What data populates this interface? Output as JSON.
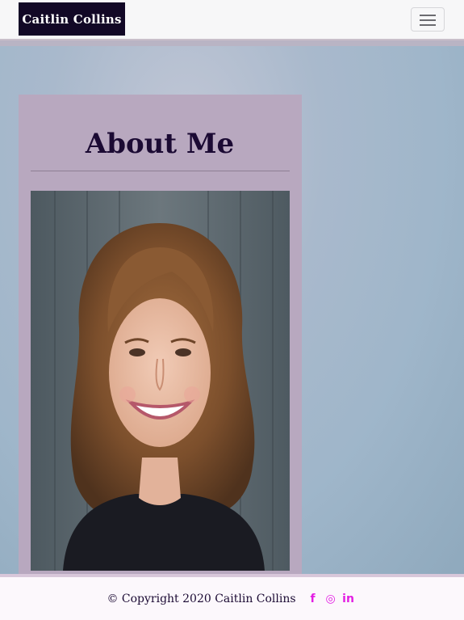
{
  "navbar": {
    "brand": "Caitlin Collins",
    "toggle_icon": "hamburger-menu-icon"
  },
  "main": {
    "title": "About Me",
    "portrait_icon": "portrait-photo"
  },
  "footer": {
    "copyright": "© Copyright 2020 Caitlin Collins",
    "social": [
      {
        "name": "facebook-icon",
        "glyph": "f"
      },
      {
        "name": "instagram-icon",
        "glyph": "◎"
      },
      {
        "name": "linkedin-icon",
        "glyph": "in"
      }
    ],
    "accent": "#e31ee3"
  },
  "colors": {
    "brand_bg": "#120826",
    "card_bg": "#b8a8bf",
    "title": "#1b0a33"
  }
}
